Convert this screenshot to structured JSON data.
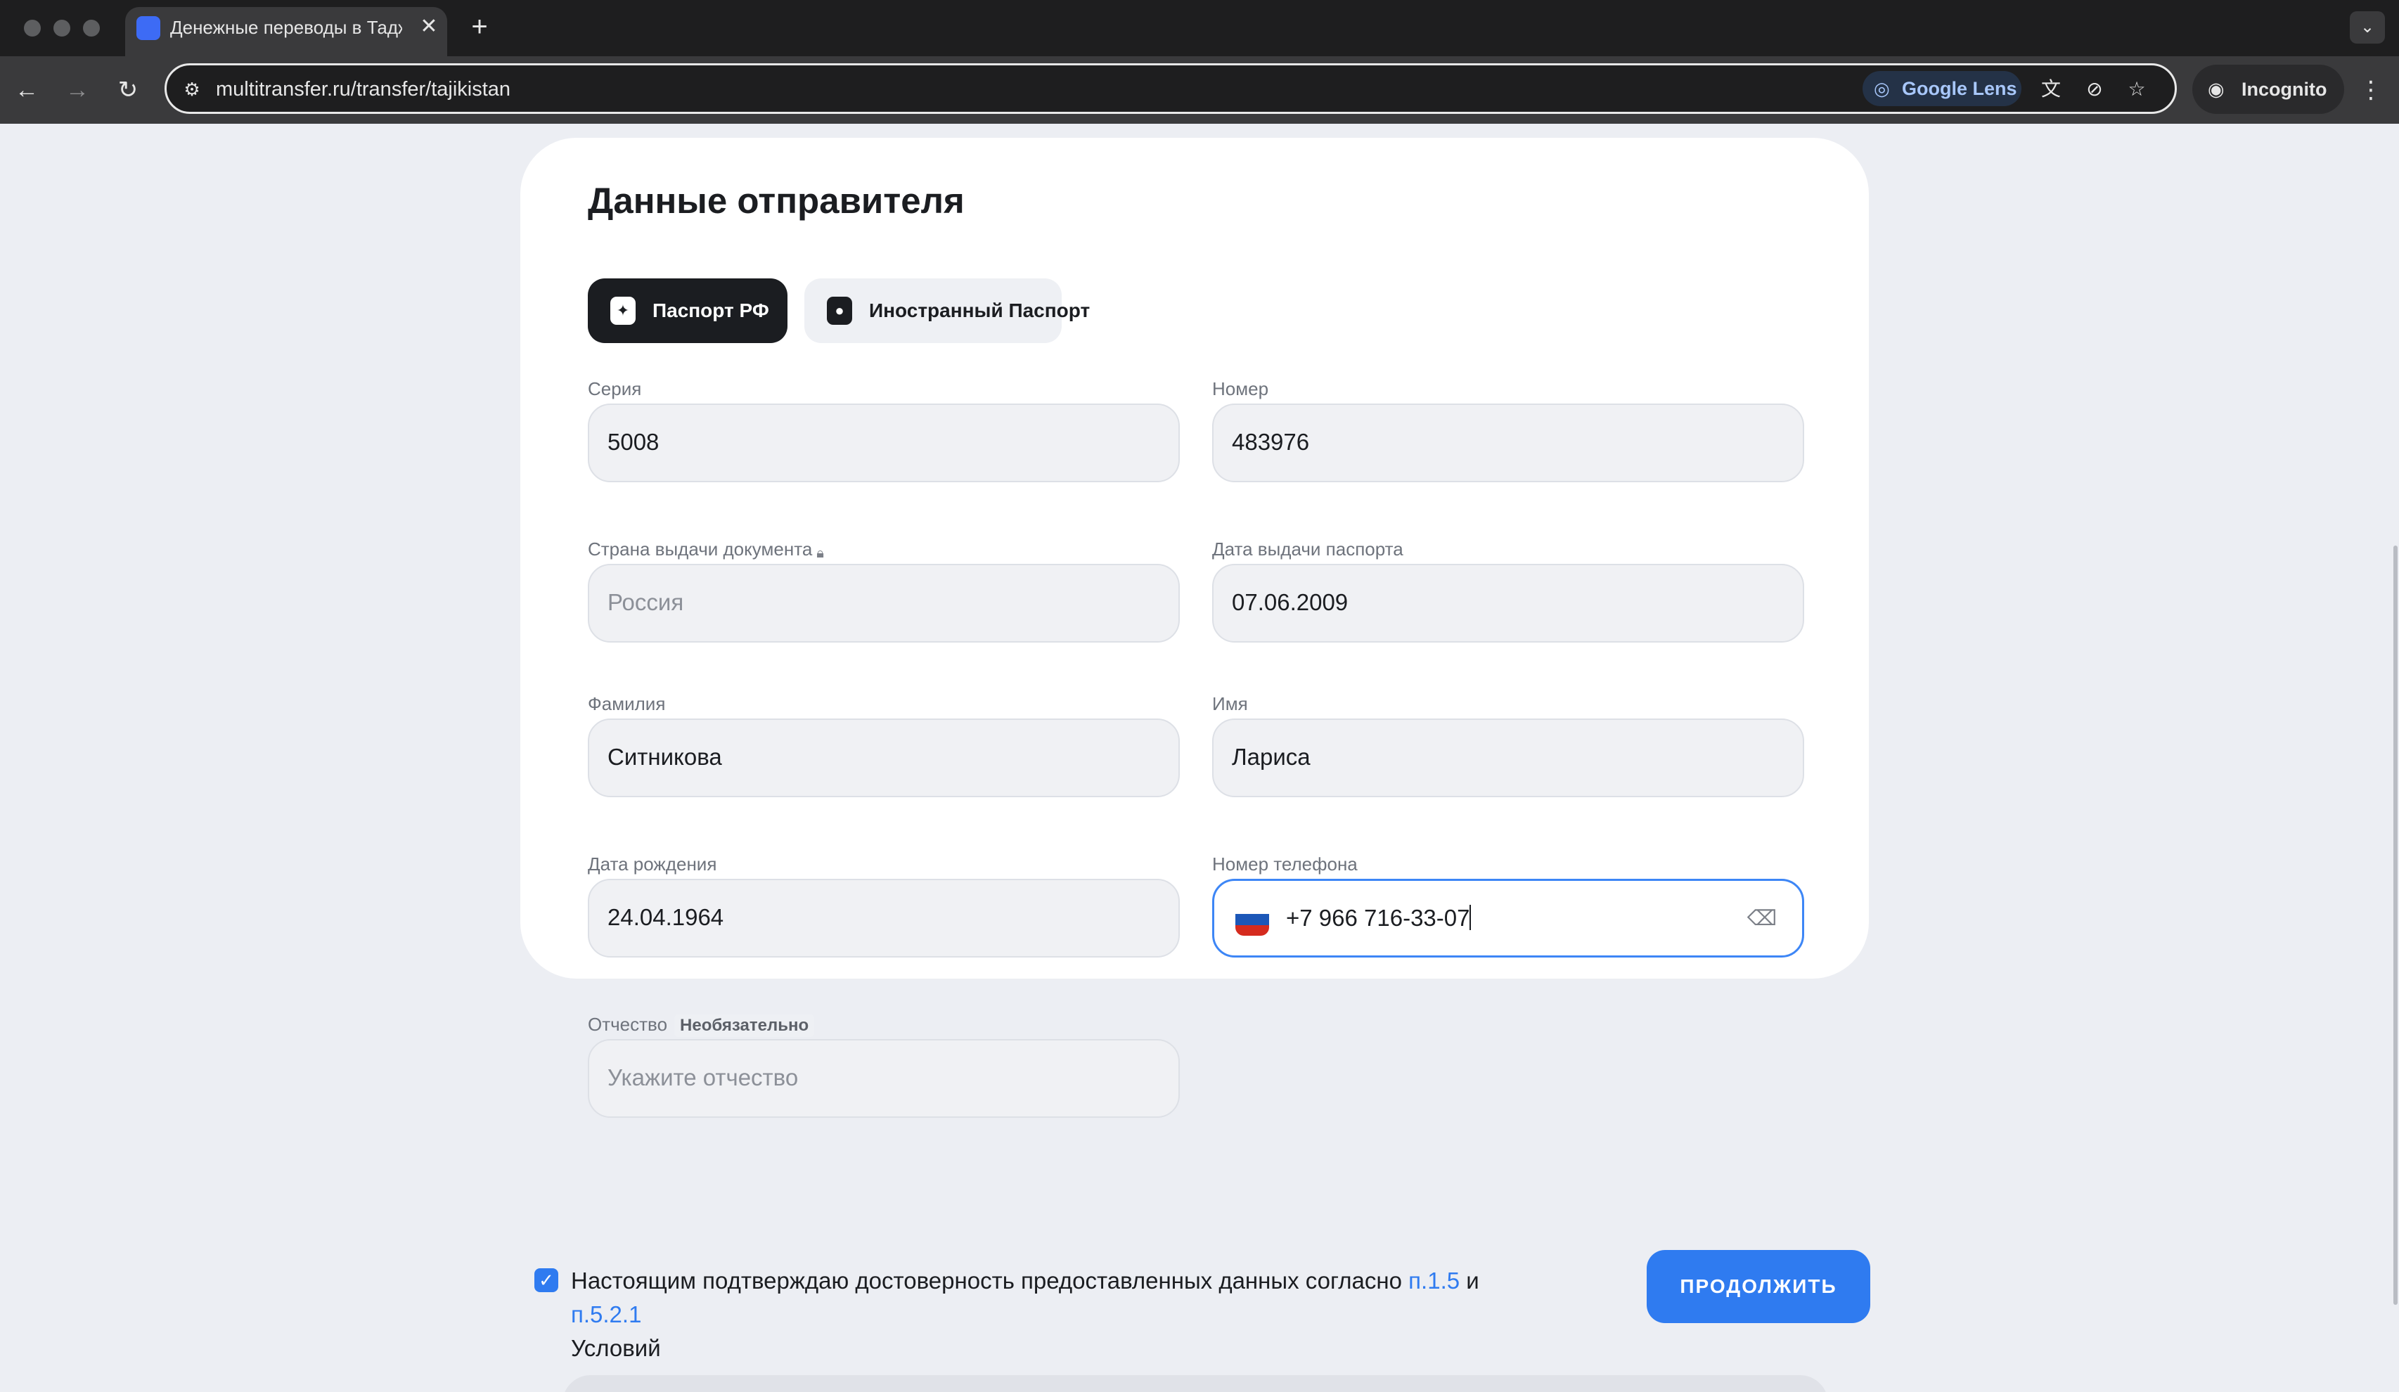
{
  "browser": {
    "tab_title": "Денежные переводы в Таджикистан",
    "tab_close": "✕",
    "new_tab": "+",
    "url": "multitransfer.ru/transfer/tajikistan",
    "lens_label": "Google Lens",
    "incognito_label": "Incognito",
    "icons": [
      "back-icon",
      "forward-icon",
      "reload-icon",
      "site-settings-icon",
      "translate-icon",
      "eye-off-icon",
      "star-icon",
      "incognito-icon",
      "kebab-icon"
    ]
  },
  "form": {
    "title": "Данные отправителя",
    "doc_types": [
      {
        "label": "Паспорт РФ",
        "active": true
      },
      {
        "label": "Иностранный Паспорт",
        "active": false
      }
    ],
    "fields": {
      "series": {
        "label": "Серия",
        "value": "5008"
      },
      "number": {
        "label": "Номер",
        "value": "483976"
      },
      "country": {
        "label": "Страна выдачи документа",
        "value": "Россия"
      },
      "issue_date": {
        "label": "Дата выдачи паспорта",
        "value": "07.06.2009"
      },
      "surname": {
        "label": "Фамилия",
        "value": "Ситникова"
      },
      "name": {
        "label": "Имя",
        "value": "Лариса"
      },
      "birth_date": {
        "label": "Дата рождения",
        "value": "24.04.1964"
      },
      "phone": {
        "label": "Номер телефона",
        "value": "+7 966 716-33-07"
      },
      "patronymic": {
        "label": "Отчество",
        "optional_badge": "Необязательно",
        "placeholder": "Укажите отчество"
      }
    }
  },
  "footer": {
    "consent_text": "Настоящим подтверждаю достоверность предоставленных данных согласно",
    "link1": "п.1.5",
    "conj": "и",
    "link2": "п.5.2.1",
    "consent_tail": "Условий",
    "checked": true,
    "continue_label": "ПРОДОЛЖИТЬ"
  },
  "colors": {
    "accent": "#2f7bf0",
    "dark": "#1b1d21",
    "field_bg": "#f0f1f4"
  }
}
